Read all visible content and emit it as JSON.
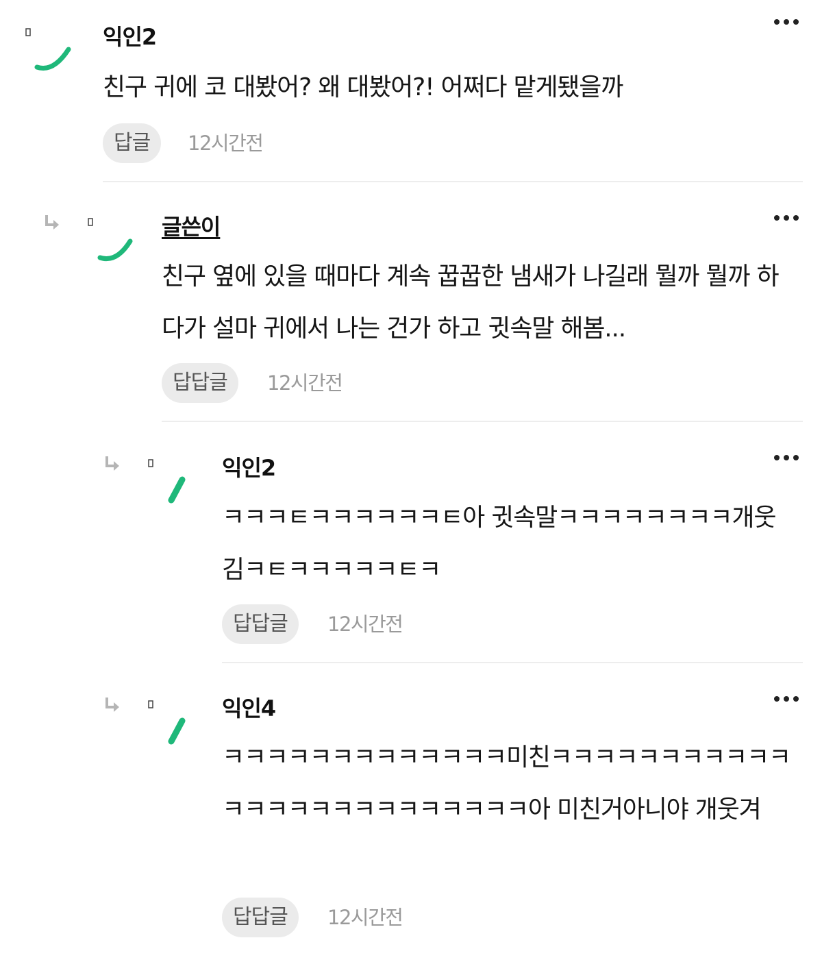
{
  "comments": [
    {
      "author": "익인2",
      "text": "친구 귀에 코 대봤어? 왜 대봤어?! 어쩌다 맡게됐을까",
      "reply_label": "답글",
      "time": "12시간전",
      "more_icon": "more-horizontal-icon",
      "avatar_icon": "avatar-green-arc-icon",
      "accent_color": "#1fb87a"
    },
    {
      "author": "글쓴이",
      "text": "친구 옆에 있을 때마다 계속 꿉꿉한 냄새가 나길래 뭘까 뭘까 하다가 설마 귀에서 나는 건가 하고 귓속말 해봄...",
      "reply_label": "답답글",
      "time": "12시간전",
      "reply_arrow_icon": "reply-arrow-icon",
      "more_icon": "more-horizontal-icon",
      "avatar_icon": "avatar-green-arc-icon",
      "accent_color": "#1fb87a"
    },
    {
      "author": "익인2",
      "text": "ㅋㅋㅋㅌㅋㅋㅋㅋㅋㅋㅌ아 귓속말ㅋㅋㅋㅋㅋㅋㅋㅋ개웃김ㅋㅌㅋㅋㅋㅋㅋㅌㅋ",
      "reply_label": "답답글",
      "time": "12시간전",
      "reply_arrow_icon": "reply-arrow-icon",
      "more_icon": "more-horizontal-icon",
      "avatar_icon": "avatar-green-slash-icon",
      "accent_color": "#1fb87a"
    },
    {
      "author": "익인4",
      "text": "ㅋㅋㅋㅋㅋㅋㅋㅋㅋㅋㅋㅋㅋ미친ㅋㅋㅋㅋㅋㅋㅋㅋㅋㅋㅋㅋㅋㅋㅋㅋㅋㅋㅋㅋㅋㅋㅋㅋㅋ아 미친거아니야 개웃겨",
      "reply_label": "답답글",
      "time": "12시간전",
      "reply_arrow_icon": "reply-arrow-icon",
      "more_icon": "more-horizontal-icon",
      "avatar_icon": "avatar-green-slash-icon",
      "accent_color": "#1fb87a"
    }
  ]
}
